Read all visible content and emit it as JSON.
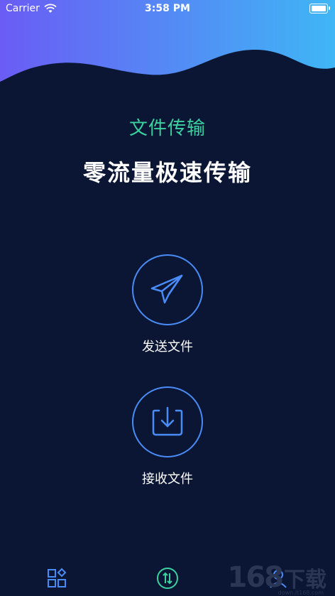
{
  "status_bar": {
    "carrier": "Carrier",
    "time": "3:58 PM",
    "icons": [
      "wifi-icon",
      "battery-icon"
    ]
  },
  "header": {
    "subtitle": "文件传输",
    "title": "零流量极速传输"
  },
  "actions": {
    "send": {
      "label": "发送文件",
      "icon": "paper-plane-icon"
    },
    "receive": {
      "label": "接收文件",
      "icon": "download-icon"
    }
  },
  "tabbar": {
    "items": [
      {
        "icon": "apps-grid-icon"
      },
      {
        "icon": "transfer-icon"
      },
      {
        "icon": "profile-icon"
      }
    ]
  },
  "watermark": {
    "number": "168",
    "text": "下载",
    "url": "down.it168.com"
  },
  "colors": {
    "background": "#0b1634",
    "accent_green": "#3ad29f",
    "accent_blue": "#4a8cf7",
    "wave_start": "#6a5cf5",
    "wave_end": "#3fb6f5"
  }
}
